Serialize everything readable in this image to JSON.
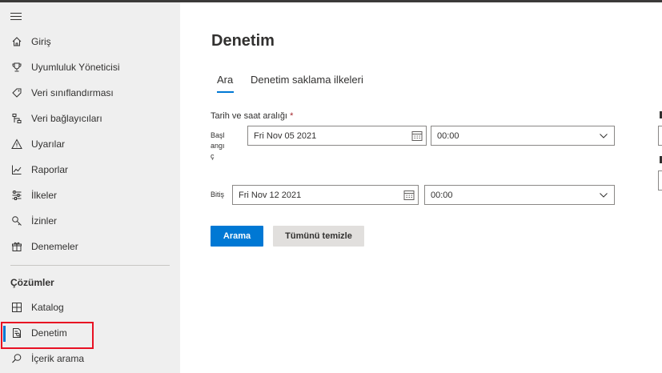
{
  "sidebar": {
    "items": [
      {
        "label": "Giriş",
        "icon": "home-icon"
      },
      {
        "label": "Uyumluluk Yöneticisi",
        "icon": "trophy-icon"
      },
      {
        "label": "Veri sınıflandırması",
        "icon": "tag-icon"
      },
      {
        "label": "Veri bağlayıcıları",
        "icon": "connector-icon"
      },
      {
        "label": "Uyarılar",
        "icon": "warning-icon"
      },
      {
        "label": "Raporlar",
        "icon": "chart-icon"
      },
      {
        "label": "İlkeler",
        "icon": "sliders-icon"
      },
      {
        "label": "İzinler",
        "icon": "key-icon"
      },
      {
        "label": "Denemeler",
        "icon": "gift-icon"
      }
    ],
    "section_title": "Çözümler",
    "solutions": [
      {
        "label": "Katalog",
        "icon": "catalog-icon"
      },
      {
        "label": "Denetim",
        "icon": "audit-icon"
      },
      {
        "label": "İçerik arama",
        "icon": "search-icon"
      }
    ]
  },
  "main": {
    "title": "Denetim",
    "tabs": [
      {
        "label": "Ara"
      },
      {
        "label": "Denetim saklama ilkeleri"
      }
    ],
    "date_range_label": "Tarih ve saat aralığı",
    "required_mark": "*",
    "start": {
      "label_line1": "Başl",
      "label_line2": "angı",
      "label_line3": "ç",
      "date": "Fri Nov 05 2021",
      "time": "00:00"
    },
    "end": {
      "label": "Bitiş",
      "date": "Fri Nov 12 2021",
      "time": "00:00"
    },
    "search_button": "Arama",
    "clear_button": "Tümünü temizle"
  },
  "colors": {
    "accent": "#0078d4",
    "highlight": "#e81123",
    "sidebar_bg": "#efefef"
  }
}
